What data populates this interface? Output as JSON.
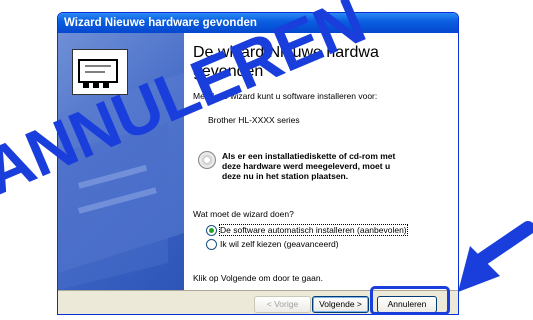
{
  "window": {
    "title": "Wizard Nieuwe hardware gevonden"
  },
  "content": {
    "heading_line1": "De wizard Nieuwe hardwa",
    "heading_line2": "gevonden",
    "intro": "Met deze wizard kunt u software installeren voor:",
    "device": "Brother HL-XXXX series",
    "cd_text_line1": "Als er een installatiediskette of cd-rom met",
    "cd_text_line2": "deze hardware werd meegeleverd, moet u",
    "cd_text_line3": "deze nu in het station plaatsen.",
    "question": "Wat moet de wizard doen?",
    "option_auto": "De software automatisch installeren (aanbevolen)",
    "option_manual": "Ik wil zelf kiezen (geavanceerd)",
    "instruction": "Klik op Volgende om door te gaan."
  },
  "buttons": {
    "back": "< Vorige",
    "next": "Volgende >",
    "cancel": "Annuleren"
  },
  "overlay": {
    "watermark": "ANNULEREN",
    "accent_color": "#1a3edc"
  },
  "radio_selected": "option_auto"
}
